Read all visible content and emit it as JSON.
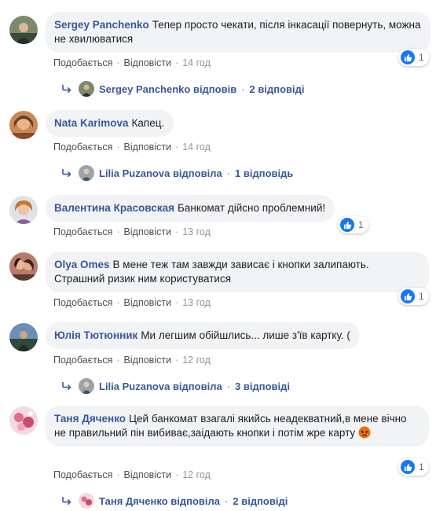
{
  "ui": {
    "like_label": "Подобається",
    "reply_label": "Відповісти",
    "separator": "·"
  },
  "comments": [
    {
      "author": "Sergey Panchenko",
      "text": "Тепер просто чекати, після інкасації повернуть, можна не хвилюватися",
      "time": "14 год",
      "reactions": "1",
      "reply_summary": {
        "name": "Sergey Panchenko",
        "verb": "відповів",
        "count": "2 відповіді"
      }
    },
    {
      "author": "Nata Karimova",
      "text": "Капец.",
      "time": "14 год",
      "reply_summary": {
        "name": "Lilia Puzanova",
        "verb": "відповіла",
        "count": "1 відповідь"
      }
    },
    {
      "author": "Валентина Красовская",
      "text": "Банкомат дійсно проблемний!",
      "time": "13 год",
      "reactions": "1"
    },
    {
      "author": "Olya Omes",
      "text": "В мене теж там завжди зависає і кнопки залипають. Страшний ризик ним користуватися",
      "time": "13 год",
      "reactions": "1"
    },
    {
      "author": "Юлія Тютюнник",
      "text": "Ми легшим обійшлись... лише з'їв картку. (",
      "time": "12 год",
      "reply_summary": {
        "name": "Lilia Puzanova",
        "verb": "відповіла",
        "count": "3 відповіді"
      }
    },
    {
      "author": "Таня Дяченко",
      "text": "Цей банкомат взагалі якийсь неадекватний,в мене вічно не правильний пін вибиває,заідають кнопки і потім жре карту",
      "time": "12 год",
      "reactions": "1",
      "emoji": "angry-face-icon",
      "reply_summary": {
        "name": "Таня Дяченко",
        "verb": "відповіла",
        "count": "2 відповіді"
      }
    }
  ],
  "colors": {
    "author": "#385898",
    "bubble": "#f2f3f5",
    "like_blue": "#1877f2",
    "meta": "#90949c"
  }
}
